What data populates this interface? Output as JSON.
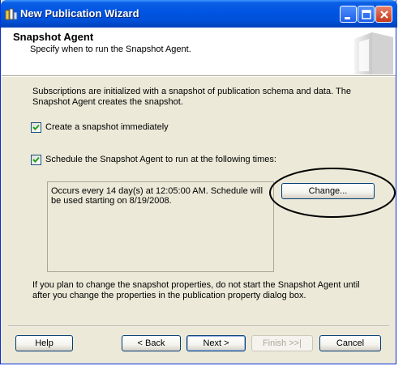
{
  "window": {
    "title": "New Publication Wizard"
  },
  "header": {
    "title": "Snapshot Agent",
    "subtitle": "Specify when to run the Snapshot Agent."
  },
  "intro": "Subscriptions are initialized with a snapshot of publication schema and data. The Snapshot Agent creates the snapshot.",
  "options": {
    "create_snapshot": {
      "label": "Create a snapshot immediately",
      "checked": true
    },
    "schedule_agent": {
      "label": "Schedule the Snapshot Agent to run at the following times:",
      "checked": true
    }
  },
  "schedule": {
    "description": "Occurs every 14 day(s) at 12:05:00 AM. Schedule will be used starting on 8/19/2008.",
    "change_label": "Change..."
  },
  "note": "If you plan to change the snapshot properties, do not start the Snapshot Agent until after you change the properties in the publication property dialog box.",
  "footer": {
    "help_label": "Help",
    "back_label": "< Back",
    "next_label": "Next >",
    "finish_label": "Finish >>|",
    "cancel_label": "Cancel"
  },
  "icons": [
    "app-icon",
    "minimize-icon",
    "maximize-icon",
    "close-icon",
    "wizard-graphic-icon",
    "checkmark-icon"
  ]
}
